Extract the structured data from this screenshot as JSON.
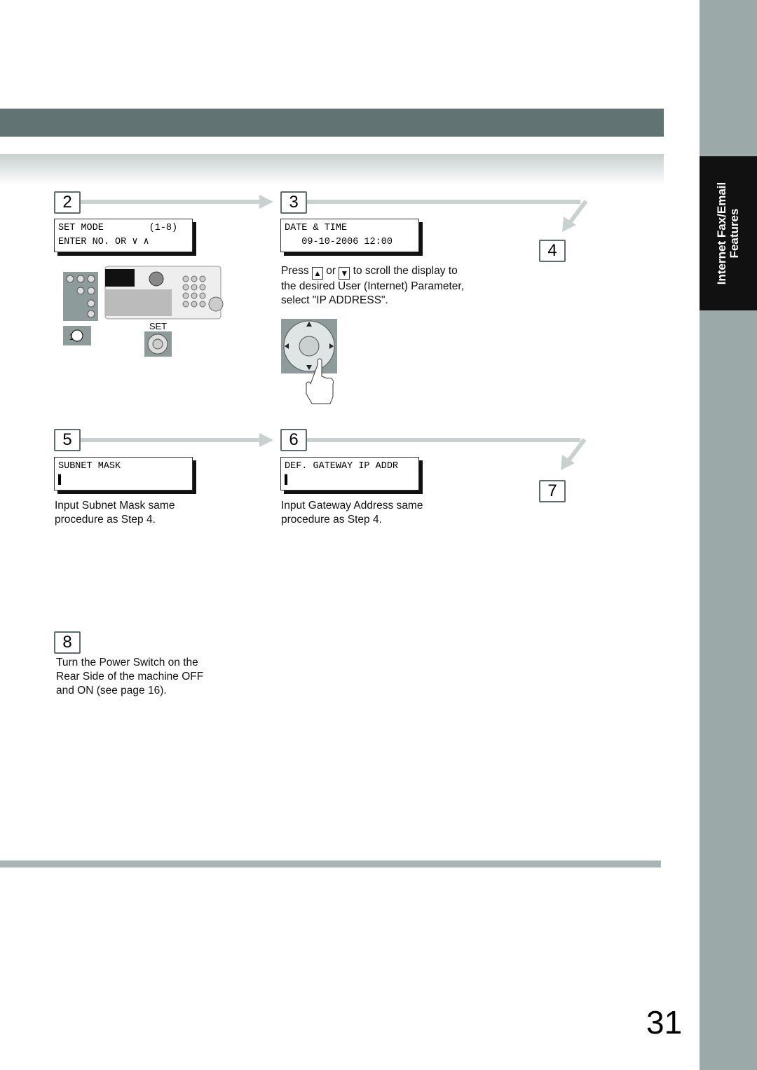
{
  "sidebar": {
    "tab_line1": "Internet Fax/Email",
    "tab_line2": "Features"
  },
  "page_number": "31",
  "steps": [
    {
      "num": "2",
      "lcd": [
        "SET MODE        (1-8)",
        "ENTER NO. OR ∨ ∧"
      ],
      "labels": {
        "set": "SET",
        "key1": "1"
      }
    },
    {
      "num": "3",
      "lcd": [
        "DATE & TIME",
        "   09-10-2006 12:00"
      ],
      "text": {
        "a": "Press",
        "b": "or",
        "c": "to scroll the display to",
        "line2": "the desired User (Internet) Parameter,",
        "line3": "select \"IP ADDRESS\"."
      },
      "icons": [
        "up-key-icon",
        "down-key-icon"
      ]
    },
    {
      "num": "4"
    },
    {
      "num": "5",
      "lcd": [
        "SUBNET MASK",
        "▌"
      ],
      "text": [
        "Input Subnet Mask same",
        "procedure as Step 4."
      ]
    },
    {
      "num": "6",
      "lcd": [
        "DEF. GATEWAY IP ADDR",
        "▌"
      ],
      "text": [
        "Input Gateway Address same",
        "procedure as Step 4."
      ]
    },
    {
      "num": "7"
    },
    {
      "num": "8",
      "text": [
        "Turn the Power Switch on the",
        "Rear Side of the machine OFF",
        "and ON (see page 16)."
      ]
    }
  ],
  "colors": {
    "sidebar": "#9ca9a9",
    "header_bar": "#617373",
    "tab": "#111111"
  }
}
